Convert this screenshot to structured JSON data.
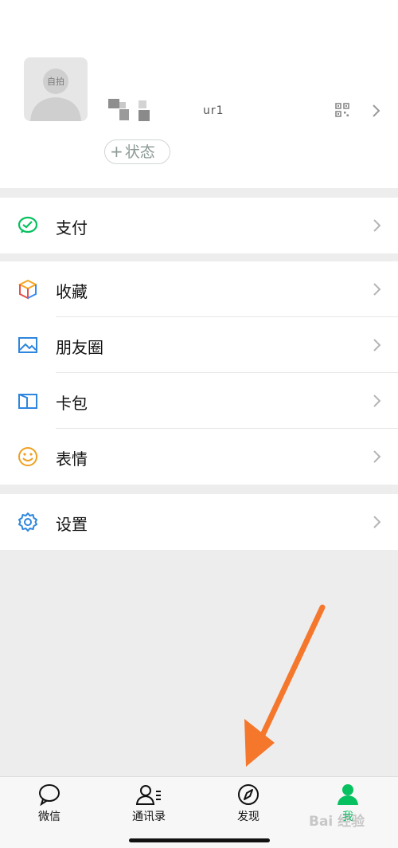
{
  "profile": {
    "avatar_label": "自拍",
    "wxid_fragment": "ur1",
    "status_button": "状态",
    "status_plus": "+"
  },
  "menu": {
    "pay": "支付",
    "favorites": "收藏",
    "moments": "朋友圈",
    "cards": "卡包",
    "stickers": "表情",
    "settings": "设置"
  },
  "icons": {
    "pay": "pay-icon",
    "favorites": "favorites-cube-icon",
    "moments": "moments-picture-icon",
    "cards": "card-wallet-icon",
    "stickers": "smiley-icon",
    "settings": "gear-icon"
  },
  "tabs": [
    {
      "label": "微信",
      "icon": "chat-bubble-icon",
      "active": false
    },
    {
      "label": "通讯录",
      "icon": "contacts-icon",
      "active": false
    },
    {
      "label": "发现",
      "icon": "compass-icon",
      "active": false
    },
    {
      "label": "我",
      "icon": "person-icon",
      "active": true
    }
  ],
  "colors": {
    "brand_green": "#07c160",
    "annotation_orange": "#f5772b"
  },
  "watermark": "Bai 经验"
}
